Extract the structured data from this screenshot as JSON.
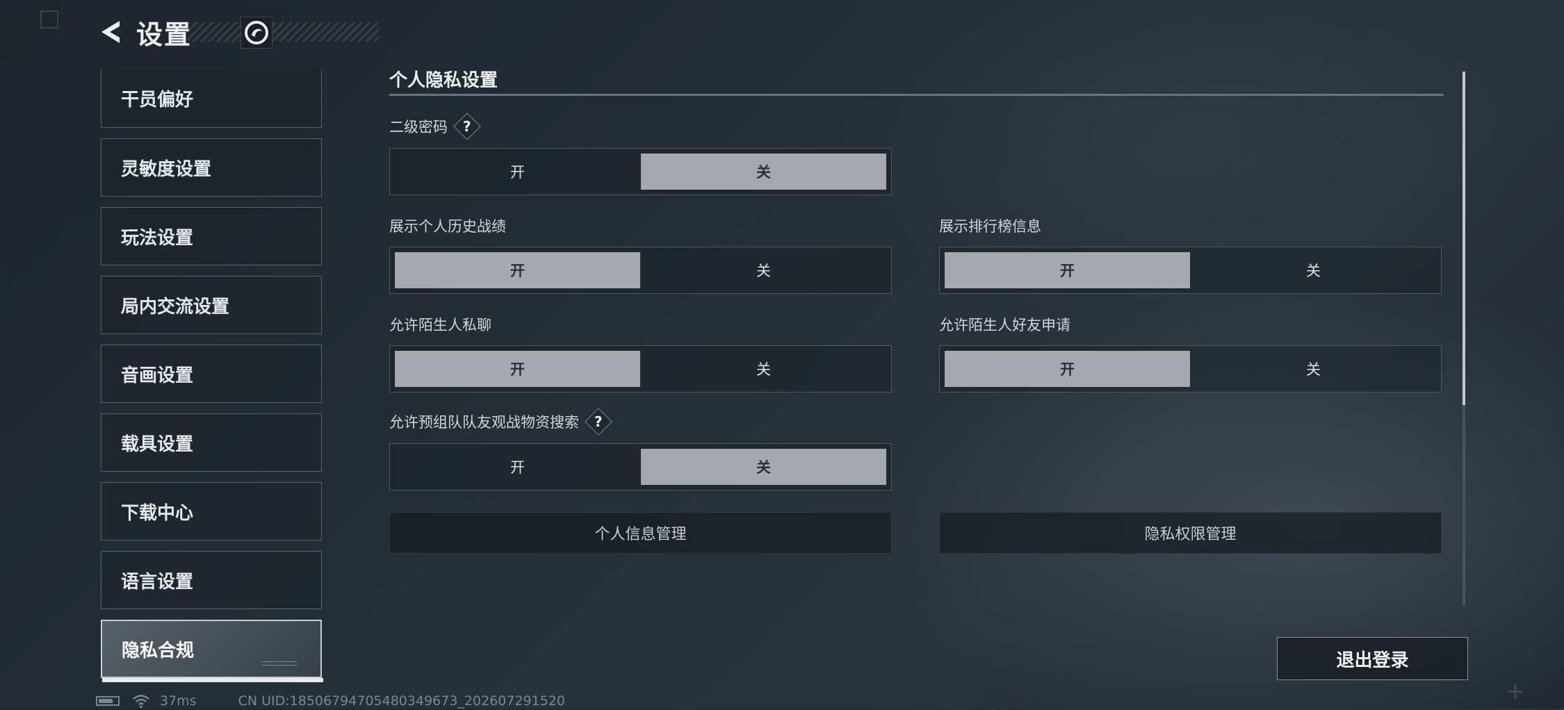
{
  "header": {
    "title": "设置"
  },
  "sidebar": {
    "items": [
      {
        "label": "干员偏好"
      },
      {
        "label": "灵敏度设置"
      },
      {
        "label": "玩法设置"
      },
      {
        "label": "局内交流设置"
      },
      {
        "label": "音画设置"
      },
      {
        "label": "载具设置"
      },
      {
        "label": "下载中心"
      },
      {
        "label": "语言设置"
      },
      {
        "label": "隐私合规",
        "active": true
      }
    ]
  },
  "privacy": {
    "section_title": "个人隐私设置",
    "settings": [
      {
        "label": "二级密码",
        "help": "?",
        "on_label": "开",
        "off_label": "关",
        "selected": "关"
      },
      {
        "label": "展示个人历史战绩",
        "on_label": "开",
        "off_label": "关",
        "selected": "开"
      },
      {
        "label": "展示排行榜信息",
        "on_label": "开",
        "off_label": "关",
        "selected": "开"
      },
      {
        "label": "允许陌生人私聊",
        "on_label": "开",
        "off_label": "关",
        "selected": "开"
      },
      {
        "label": "允许陌生人好友申请",
        "on_label": "开",
        "off_label": "关",
        "selected": "开"
      },
      {
        "label": "允许预组队队友观战物资搜索",
        "help": "?",
        "on_label": "开",
        "off_label": "关",
        "selected": "关"
      }
    ],
    "buttons": {
      "personal_info": "个人信息管理",
      "privacy_permissions": "隐私权限管理"
    }
  },
  "logout_label": "退出登录",
  "status": {
    "ping": "37ms",
    "uid": "CN UID:18506794705480349673_202607291520"
  },
  "colors": {
    "selected_option_bg": "#a5a9ad",
    "background": "#252d35"
  }
}
